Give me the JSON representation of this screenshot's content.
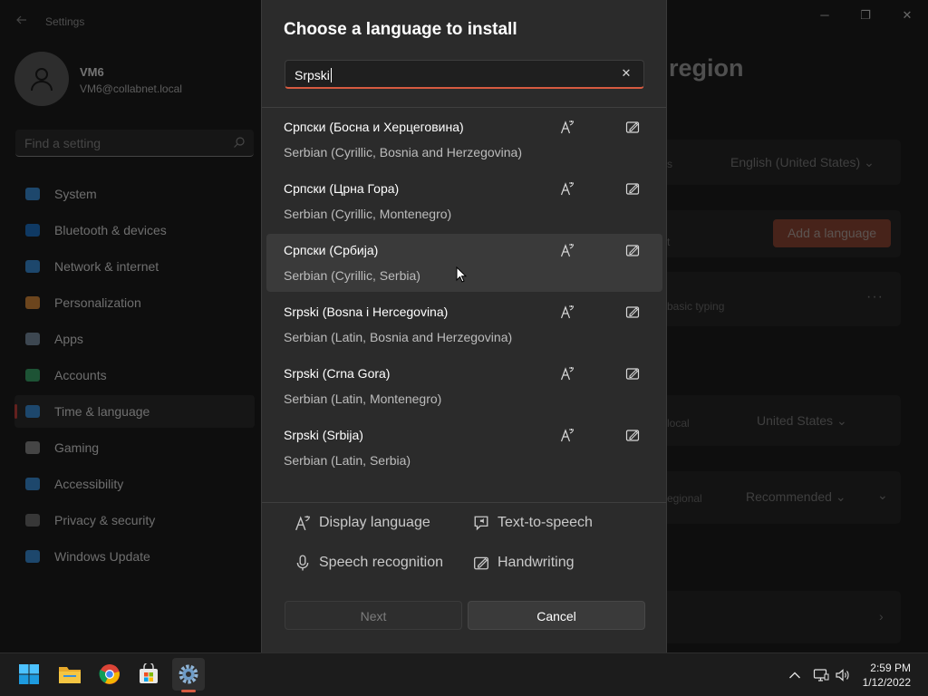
{
  "window": {
    "title": "Settings",
    "minimize_glyph": "─",
    "maximize_glyph": "❐",
    "close_glyph": "✕",
    "back_icon": "back-arrow-icon"
  },
  "user": {
    "name": "VM6",
    "email": "VM6@collabnet.local"
  },
  "search": {
    "placeholder": "Find a setting"
  },
  "nav": [
    {
      "label": "System",
      "icon": "system-icon",
      "color": "#3b8fd9"
    },
    {
      "label": "Bluetooth & devices",
      "icon": "bluetooth-icon",
      "color": "#1e73c6"
    },
    {
      "label": "Network & internet",
      "icon": "wifi-icon",
      "color": "#3b8fd9"
    },
    {
      "label": "Personalization",
      "icon": "brush-icon",
      "color": "#d98a3b"
    },
    {
      "label": "Apps",
      "icon": "apps-icon",
      "color": "#7a8ea3"
    },
    {
      "label": "Accounts",
      "icon": "accounts-icon",
      "color": "#3aa66b"
    },
    {
      "label": "Time & language",
      "icon": "globe-clock-icon",
      "color": "#3b8fd9",
      "active": true
    },
    {
      "label": "Gaming",
      "icon": "gamepad-icon",
      "color": "#8a8a8a"
    },
    {
      "label": "Accessibility",
      "icon": "accessibility-icon",
      "color": "#3b8fd9"
    },
    {
      "label": "Privacy & security",
      "icon": "shield-icon",
      "color": "#6e6e6e"
    },
    {
      "label": "Windows Update",
      "icon": "update-icon",
      "color": "#3b8fd9"
    }
  ],
  "background_page": {
    "title_partial": "region",
    "display_language_value": "English (United States)",
    "row1_partial": "s",
    "add_language_label": "Add a language",
    "row2_partial": "t",
    "basic_typing_partial": "basic typing",
    "region_row_partial": "local",
    "country_value": "United States",
    "format_row_partial": "egional",
    "format_value": "Recommended"
  },
  "dialog": {
    "title": "Choose a language to install",
    "search_value": "Srpski",
    "clear_glyph": "✕",
    "languages": [
      {
        "native": "Српски (Босна и Херцеговина)",
        "english": "Serbian (Cyrillic, Bosnia and Herzegovina)"
      },
      {
        "native": "Српски (Црна Гора)",
        "english": "Serbian (Cyrillic, Montenegro)"
      },
      {
        "native": "Српски (Србија)",
        "english": "Serbian (Cyrillic, Serbia)",
        "hovered": true
      },
      {
        "native": "Srpski (Bosna i Hercegovina)",
        "english": "Serbian (Latin, Bosnia and Herzegovina)"
      },
      {
        "native": "Srpski (Crna Gora)",
        "english": "Serbian (Latin, Montenegro)"
      },
      {
        "native": "Srpski (Srbija)",
        "english": "Serbian (Latin, Serbia)"
      }
    ],
    "features": {
      "display_language": "Display language",
      "text_to_speech": "Text-to-speech",
      "speech_recognition": "Speech recognition",
      "handwriting": "Handwriting"
    },
    "next_label": "Next",
    "cancel_label": "Cancel"
  },
  "taskbar": {
    "apps": [
      "start-icon",
      "file-explorer-icon",
      "chrome-icon",
      "microsoft-store-icon",
      "settings-icon"
    ],
    "time": "2:59 PM",
    "date": "1/12/2022",
    "accent": "#d65a40"
  }
}
